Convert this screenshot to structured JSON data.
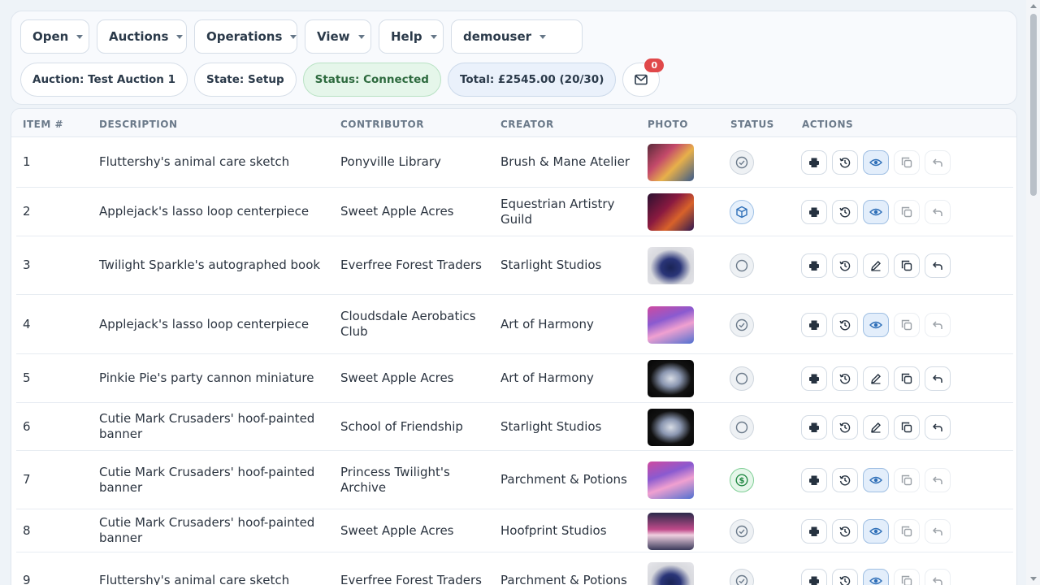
{
  "menu": [
    "Open",
    "Auctions",
    "Operations",
    "View",
    "Help",
    "demouser"
  ],
  "pills": {
    "auction": "Auction: Test Auction 1",
    "state": "State: Setup",
    "status": "Status: Connected",
    "total": "Total: £2545.00 (20/30)"
  },
  "mail": {
    "count": "0"
  },
  "table": {
    "headers": [
      "ITEM #",
      "DESCRIPTION",
      "CONTRIBUTOR",
      "CREATOR",
      "PHOTO",
      "STATUS",
      "ACTIONS"
    ],
    "rows": [
      {
        "item": "1",
        "description": "Fluttershy's animal care sketch",
        "contributor": "Ponyville Library",
        "creator": "Brush & Mane Atelier",
        "status": "check",
        "photo": "cards",
        "mode": "view"
      },
      {
        "item": "2",
        "description": "Applejack's lasso loop centerpiece",
        "contributor": "Sweet Apple Acres",
        "creator": "Equestrian Artistry Guild",
        "status": "box",
        "photo": "dark",
        "mode": "view"
      },
      {
        "item": "3",
        "description": "Twilight Sparkle's autographed book",
        "contributor": "Everfree Forest Traders",
        "creator": "Starlight Studios",
        "status": "empty",
        "photo": "figure",
        "mode": "edit"
      },
      {
        "item": "4",
        "description": "Applejack's lasso loop centerpiece",
        "contributor": "Cloudsdale Aerobatics Club",
        "creator": "Art of Harmony",
        "status": "check",
        "photo": "box",
        "mode": "view"
      },
      {
        "item": "5",
        "description": "Pinkie Pie's party cannon miniature",
        "contributor": "Sweet Apple Acres",
        "creator": "Art of Harmony",
        "status": "empty",
        "photo": "black",
        "mode": "edit"
      },
      {
        "item": "6",
        "description": "Cutie Mark Crusaders' hoof-painted banner",
        "contributor": "School of Friendship",
        "creator": "Starlight Studios",
        "status": "empty",
        "photo": "black",
        "mode": "edit"
      },
      {
        "item": "7",
        "description": "Cutie Mark Crusaders' hoof-painted banner",
        "contributor": "Princess Twilight's Archive",
        "creator": "Parchment & Potions",
        "status": "dollar",
        "photo": "box",
        "mode": "view"
      },
      {
        "item": "8",
        "description": "Cutie Mark Crusaders' hoof-painted banner",
        "contributor": "Sweet Apple Acres",
        "creator": "Hoofprint Studios",
        "status": "check",
        "photo": "stage",
        "mode": "view"
      },
      {
        "item": "9",
        "description": "Fluttershy's animal care sketch",
        "contributor": "Everfree Forest Traders",
        "creator": "Parchment & Potions",
        "status": "check",
        "photo": "figure",
        "mode": "view"
      }
    ]
  }
}
